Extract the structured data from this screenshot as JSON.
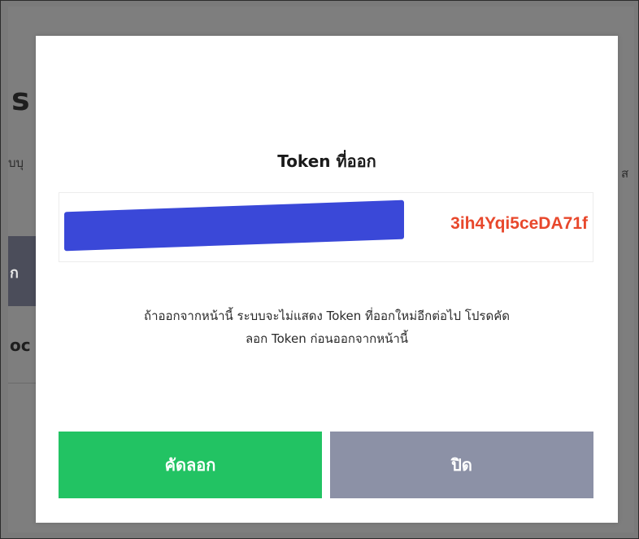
{
  "background": {
    "heading": "s",
    "subtext_left": "บบุ",
    "subtext_right": "ส",
    "tab_label": "ก",
    "row_text": "oc"
  },
  "modal": {
    "title": "Token ที่ออก",
    "token_visible_suffix": "3ih4Yqi5ceDA71f",
    "warning_line_1": "ถ้าออกจากหน้านี้ ระบบจะไม่แสดง Token ที่ออกใหม่อีกต่อไป โปรดคัด",
    "warning_line_2": "ลอก Token ก่อนออกจากหน้านี้",
    "copy_button_label": "คัดลอก",
    "close_button_label": "ปิด"
  },
  "colors": {
    "overlay": "#7e7e7e",
    "token_text": "#e8482c",
    "redaction_mask": "#3a48d8",
    "copy_button": "#22c363",
    "close_button": "#8c91a6"
  }
}
